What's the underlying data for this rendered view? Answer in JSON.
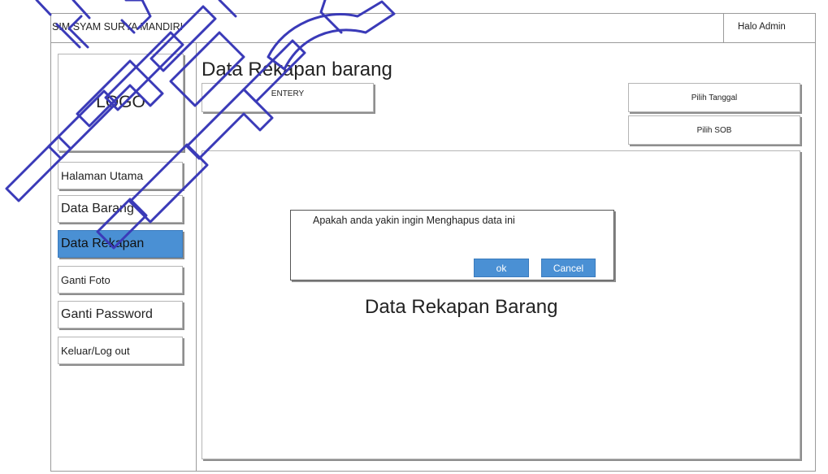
{
  "header": {
    "app_title": "SIM SYAM SURYA MANDIRI",
    "user_greeting": "Halo Admin"
  },
  "sidebar": {
    "logo_text": "LOGO",
    "items": [
      {
        "label": "Halaman Utama",
        "active": false
      },
      {
        "label": "Data Barang",
        "active": false
      },
      {
        "label": "Data Rekapan",
        "active": true
      },
      {
        "label": "Ganti Foto",
        "active": false
      },
      {
        "label": "Ganti Password",
        "active": false
      },
      {
        "label": "Keluar/Log out",
        "active": false
      }
    ]
  },
  "main": {
    "page_title": "Data Rekapan barang",
    "entry_button_label": "ENTERY",
    "date_button_label": "Pilih Tanggal",
    "sob_button_label": "Pilih SOB",
    "content_label": "Data  Rekapan Barang"
  },
  "dialog": {
    "message": "Apakah  anda yakin ingin Menghapus data ini",
    "ok_label": "ok",
    "cancel_label": "Cancel"
  },
  "colors": {
    "accent": "#4a90d4",
    "watermark": "#3a3ab8"
  }
}
